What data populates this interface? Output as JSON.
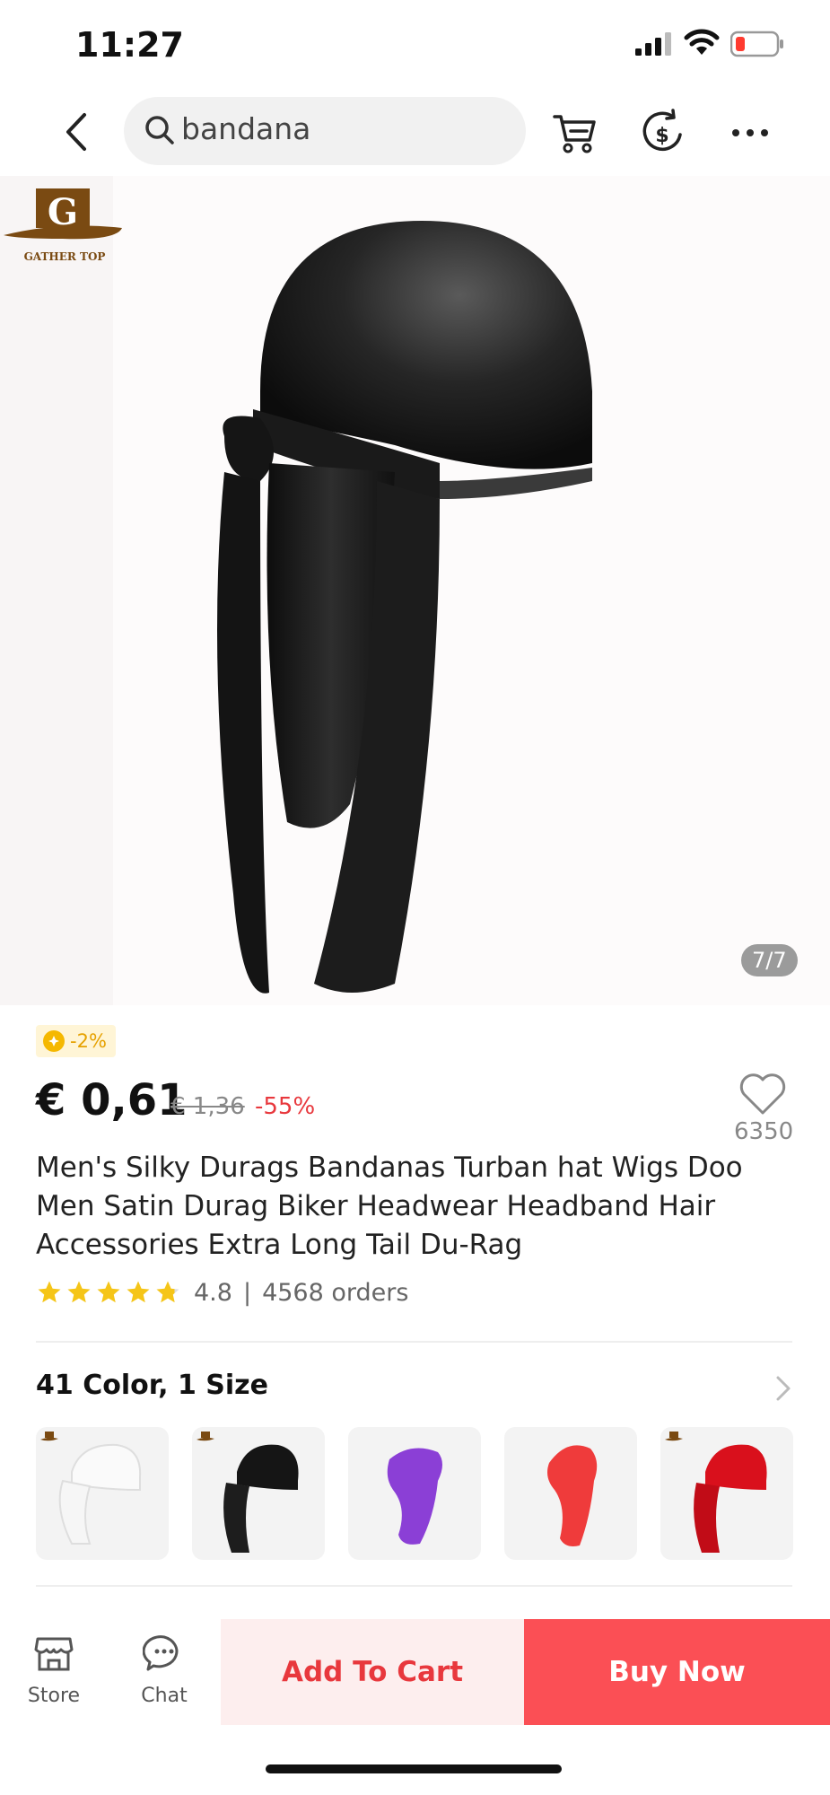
{
  "status_bar": {
    "time": "11:27"
  },
  "search": {
    "query": "bandana"
  },
  "gallery": {
    "logo_text": "GATHER TOP",
    "counter": "7/7"
  },
  "product": {
    "coin_discount": "-2%",
    "price": "€ 0,61",
    "original_price": "€ 1,36",
    "discount": "-55%",
    "wishlist_count": "6350",
    "title": "Men's Silky Durags Bandanas Turban hat Wigs Doo Men Satin Durag Biker Headwear Headband Hair Accessories Extra Long Tail Du-Rag",
    "rating": "4.8",
    "rating_stars": 4.8,
    "separator": "|",
    "orders": "4568 orders"
  },
  "variants": {
    "title": "41 Color, 1 Size",
    "swatch_colors": [
      "#ffffff",
      "#151515",
      "#8b3fd6",
      "#ef3b3b",
      "#d9101c"
    ]
  },
  "bottom_bar": {
    "store_label": "Store",
    "chat_label": "Chat",
    "add_to_cart": "Add To Cart",
    "buy_now": "Buy Now"
  },
  "colors": {
    "accent": "#fb4f55",
    "accent_light": "#fdeeee",
    "star": "#f5c518"
  }
}
